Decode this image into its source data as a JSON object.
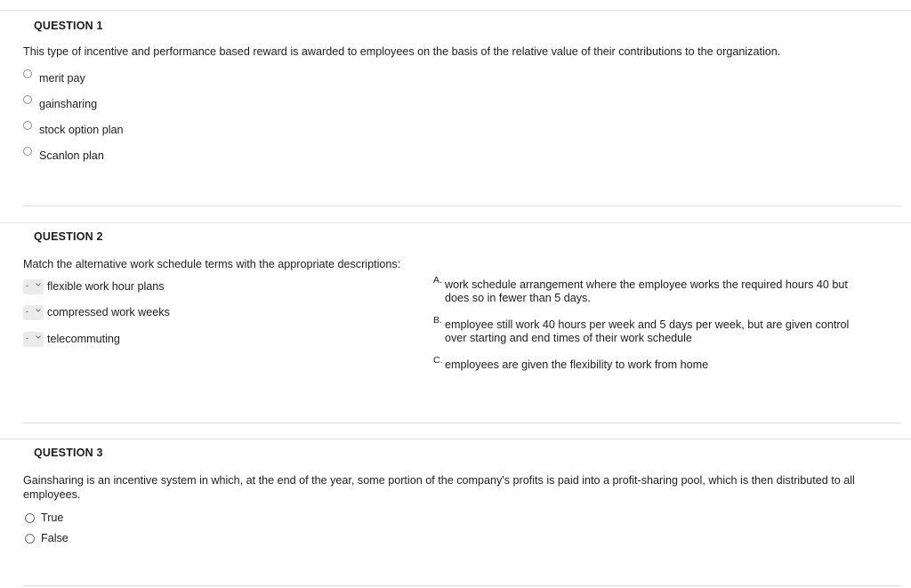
{
  "page": {
    "background": "#ffffff",
    "text_color": "#1d1d1d",
    "rule_color": "#e3e3e3"
  },
  "questions": [
    {
      "id": "q1",
      "header": "QUESTION 1",
      "prompt": "This type of incentive and performance based reward is awarded to employees on the basis of the relative value of their contributions to the organization.",
      "type": "multiple-choice",
      "options": [
        {
          "label": "merit pay",
          "selected": false
        },
        {
          "label": "gainsharing",
          "selected": false
        },
        {
          "label": "stock option plan",
          "selected": false
        },
        {
          "label": "Scanlon plan",
          "selected": false
        }
      ]
    },
    {
      "id": "q2",
      "header": "QUESTION 2",
      "prompt": "Match the alternative work schedule terms with the appropriate descriptions:",
      "type": "matching",
      "terms": [
        {
          "label": "flexible work hour plans",
          "select_value": "-"
        },
        {
          "label": "compressed work weeks",
          "select_value": "-"
        },
        {
          "label": "telecommuting",
          "select_value": "-"
        }
      ],
      "descriptions": [
        {
          "letter": "A.",
          "text": "work schedule arrangement where the employee works the required hours 40 but does so in fewer than 5 days."
        },
        {
          "letter": "B.",
          "text": "employee still work 40 hours per week and 5 days per week, but are given control over starting and end times of their work schedule"
        },
        {
          "letter": "C.",
          "text": "employees are given the flexibility to work from home"
        }
      ]
    },
    {
      "id": "q3",
      "header": "QUESTION 3",
      "prompt": "Gainsharing is an incentive system in which, at the end of the year, some portion of the company's profits is paid into a profit-sharing pool, which is then distributed to all employees.",
      "type": "true-false",
      "options": [
        {
          "label": "True",
          "selected": false
        },
        {
          "label": "False",
          "selected": false
        }
      ]
    }
  ]
}
